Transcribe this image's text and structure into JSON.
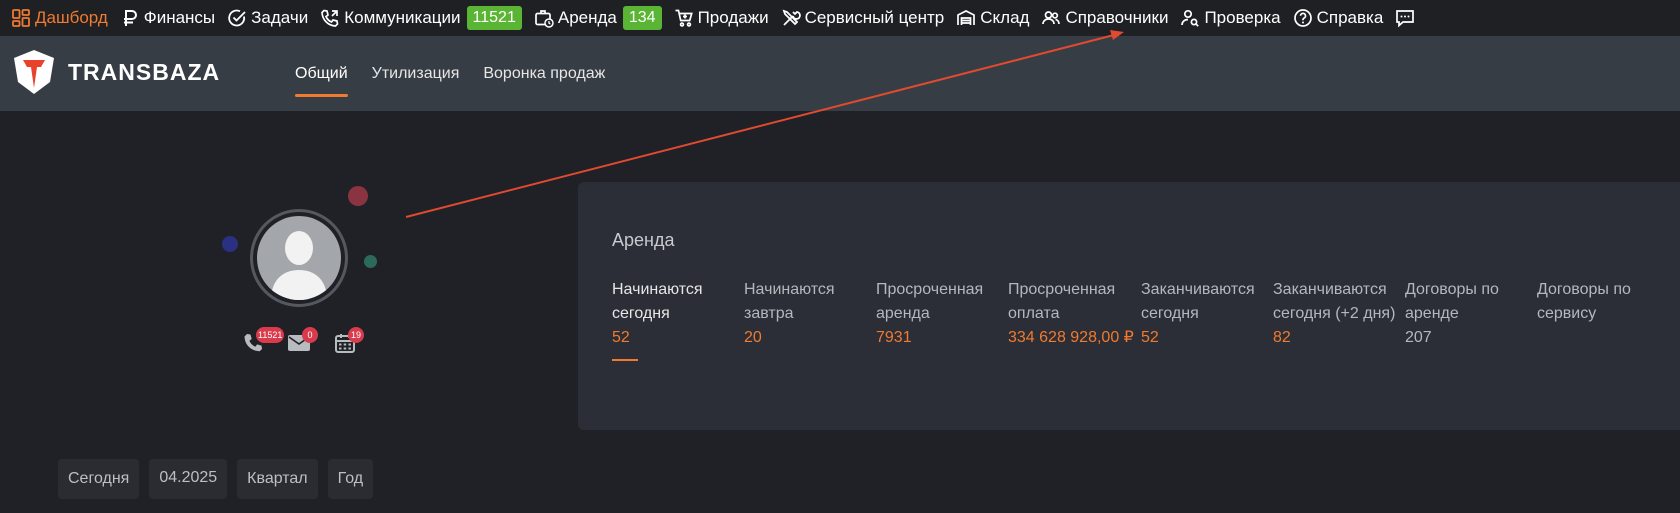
{
  "nav": {
    "items": [
      {
        "label": "Дашборд",
        "icon": "dashboard-icon"
      },
      {
        "label": "Финансы",
        "icon": "ruble-icon"
      },
      {
        "label": "Задачи",
        "icon": "check-circle-icon"
      },
      {
        "label": "Коммуникации",
        "icon": "phone-icon",
        "badge": "11521"
      },
      {
        "label": "Аренда",
        "icon": "briefcase-clock-icon",
        "badge": "134"
      },
      {
        "label": "Продажи",
        "icon": "cart-icon"
      },
      {
        "label": "Сервисный центр",
        "icon": "tools-icon"
      },
      {
        "label": "Склад",
        "icon": "warehouse-icon"
      },
      {
        "label": "Справочники",
        "icon": "users-icon"
      },
      {
        "label": "Проверка",
        "icon": "user-search-icon"
      },
      {
        "label": "Справка",
        "icon": "help-circle-icon"
      },
      {
        "label": "",
        "icon": "chat-icon"
      }
    ]
  },
  "header": {
    "logo_text": "TRANSBAZA",
    "tabs": [
      "Общий",
      "Утилизация",
      "Воронка продаж"
    ]
  },
  "profile": {
    "calls_badge": "11521",
    "mail_badge": "0",
    "calendar_badge": "19"
  },
  "rent_card": {
    "title": "Аренда",
    "stats": [
      {
        "label": "Начинаются сегодня",
        "value": "52"
      },
      {
        "label": "Начинаются завтра",
        "value": "20"
      },
      {
        "label": "Просроченная аренда",
        "value": "7931"
      },
      {
        "label": "Просроченная оплата",
        "value": "334 628 928,00 ₽"
      },
      {
        "label": "Заканчиваются сегодня",
        "value": "52"
      },
      {
        "label": "Заканчиваются сегодня (+2 дня)",
        "value": "82"
      },
      {
        "label": "Договоры по аренде",
        "value": "207"
      },
      {
        "label": "Договоры по сервису",
        "value": ""
      }
    ]
  },
  "periods": [
    "Сегодня",
    "04.2025",
    "Квартал",
    "Год"
  ],
  "colors": {
    "accent": "#f07a2f",
    "badge_green": "#5bb534",
    "badge_red": "#d93b4d",
    "arrow": "#e04a2f"
  }
}
